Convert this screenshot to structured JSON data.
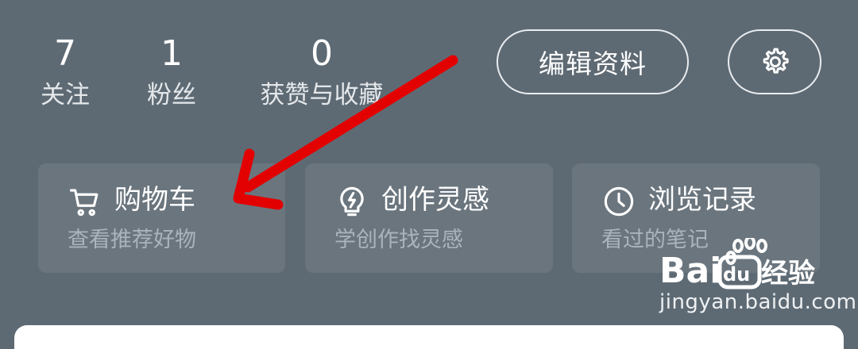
{
  "stats": [
    {
      "value": "7",
      "label": "关注"
    },
    {
      "value": "1",
      "label": "粉丝"
    },
    {
      "value": "0",
      "label": "获赞与收藏"
    }
  ],
  "buttons": {
    "edit_profile": "编辑资料",
    "settings_icon": "gear-icon"
  },
  "cards": [
    {
      "title": "购物车",
      "subtitle": "查看推荐好物",
      "icon": "shopping-cart-icon"
    },
    {
      "title": "创作灵感",
      "subtitle": "学创作找灵感",
      "icon": "lightbulb-icon"
    },
    {
      "title": "浏览记录",
      "subtitle": "看过的笔记",
      "icon": "clock-icon"
    }
  ],
  "watermark": {
    "brand": "Bai 经验",
    "url": "jingyan.baidu.com"
  },
  "colors": {
    "background": "#5e6a73",
    "card": "#6a757e",
    "arrow": "#e30000",
    "text": "#ffffff",
    "subtext": "#aab4bb"
  }
}
